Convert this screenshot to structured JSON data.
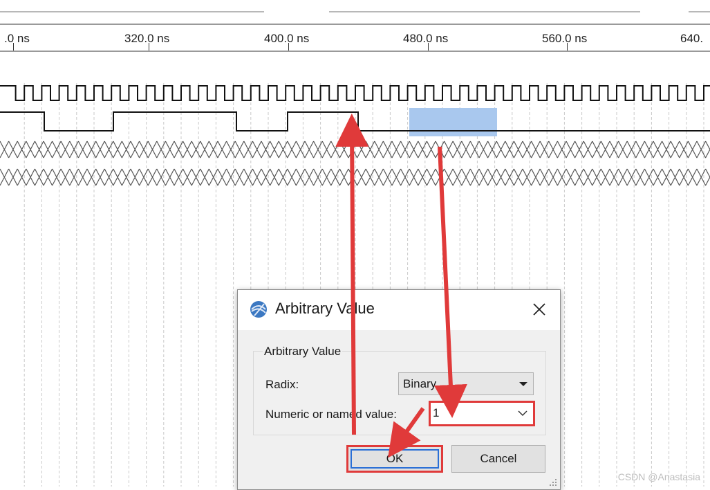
{
  "ruler": {
    "ticks": [
      ".0 ns",
      "320.0 ns",
      "400.0 ns",
      "480.0 ns",
      "560.0 ns",
      "640."
    ]
  },
  "dialog": {
    "title": "Arbitrary Value",
    "group_title": "Arbitrary Value",
    "radix_label": "Radix:",
    "radix_value": "Binary",
    "numeric_label": "Numeric or named value:",
    "numeric_value": "1",
    "ok_label": "OK",
    "cancel_label": "Cancel"
  },
  "icons": {
    "app": "intel-quartus-globe-icon",
    "close": "close-icon",
    "dropdown": "chevron-down-icon"
  },
  "colors": {
    "highlight": "#a9c8ee",
    "annotation": "#e03a3a",
    "focus": "#2a6fd6"
  },
  "watermark": "CSDN @Anastasia"
}
